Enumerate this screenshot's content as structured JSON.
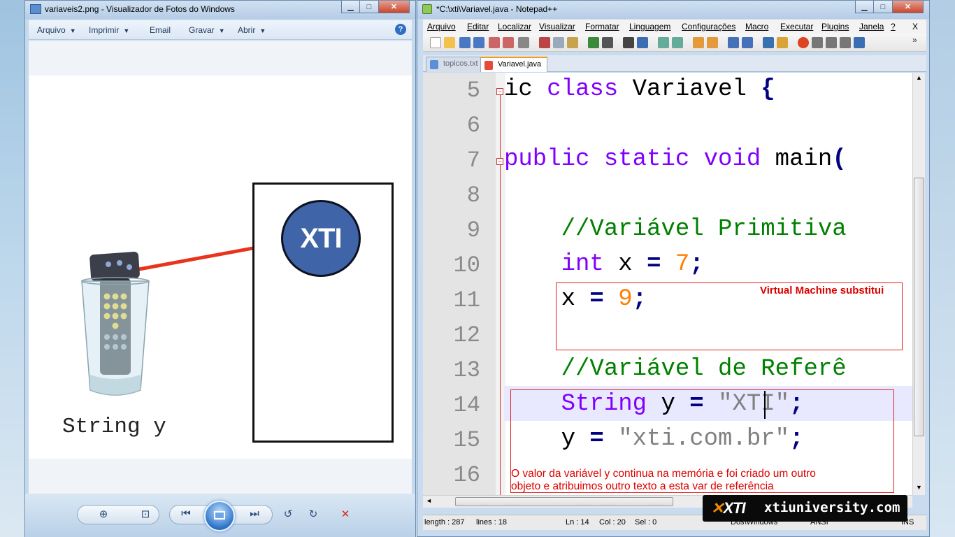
{
  "viewer": {
    "title": "variaveis2.png - Visualizador de Fotos do Windows",
    "menu": [
      {
        "label": "Arquivo",
        "caret": "▼"
      },
      {
        "label": "Imprimir",
        "caret": "▼"
      },
      {
        "label": "Email",
        "caret": ""
      },
      {
        "label": "Gravar",
        "caret": "▼"
      },
      {
        "label": "Abrir",
        "caret": "▼"
      }
    ],
    "help_label": "?",
    "image": {
      "circle_label": "XTI",
      "caption": "String y"
    }
  },
  "npp": {
    "title": "*C:\\xti\\Variavel.java - Notepad++",
    "menu": [
      "Arquivo",
      "Editar",
      "Localizar",
      "Visualizar",
      "Formatar",
      "Linguagem",
      "Configurações",
      "Macro",
      "Executar",
      "Plugins",
      "Janela",
      "?"
    ],
    "menu_close": "X",
    "tabs": [
      {
        "label": "topicos.txt",
        "active": false
      },
      {
        "label": "Variavel.java",
        "active": true
      }
    ],
    "lines": [
      {
        "n": "5",
        "code": "ic class Variavel {"
      },
      {
        "n": "6",
        "code": ""
      },
      {
        "n": "7",
        "code": "public static void main("
      },
      {
        "n": "8",
        "code": ""
      },
      {
        "n": "9",
        "code": "    //Variável Primitiva"
      },
      {
        "n": "10",
        "code": "    int x = 7;"
      },
      {
        "n": "11",
        "code": "    x = 9;"
      },
      {
        "n": "12",
        "code": ""
      },
      {
        "n": "13",
        "code": "    //Variável de Referê"
      },
      {
        "n": "14",
        "code": "    String y = \"XTI\";"
      },
      {
        "n": "15",
        "code": "    y = \"xti.com.br\";"
      },
      {
        "n": "16",
        "code": ""
      }
    ],
    "status": {
      "length": "length : 287",
      "lines": "lines : 18",
      "ln": "Ln : 14",
      "col": "Col : 20",
      "sel": "Sel : 0",
      "eol": "Dos\\Windows",
      "enc": "ANSI",
      "mode": "INS"
    }
  },
  "annotations": {
    "vm_note": "Virtual Machine substitui",
    "ref_note_line1": "O valor da variável y continua na memória e foi criado um outro",
    "ref_note_line2": "objeto e atribuimos outro texto a esta var de referência"
  },
  "brand": {
    "logo": "XTI",
    "text": "xtiuniversity.com"
  },
  "colors": {
    "keyword": "#8000ff",
    "number": "#ff8000",
    "comment": "#008000",
    "string": "#808080",
    "annotation": "#dd0000",
    "circle": "#3f64a7",
    "red_line": "#e8341c"
  }
}
